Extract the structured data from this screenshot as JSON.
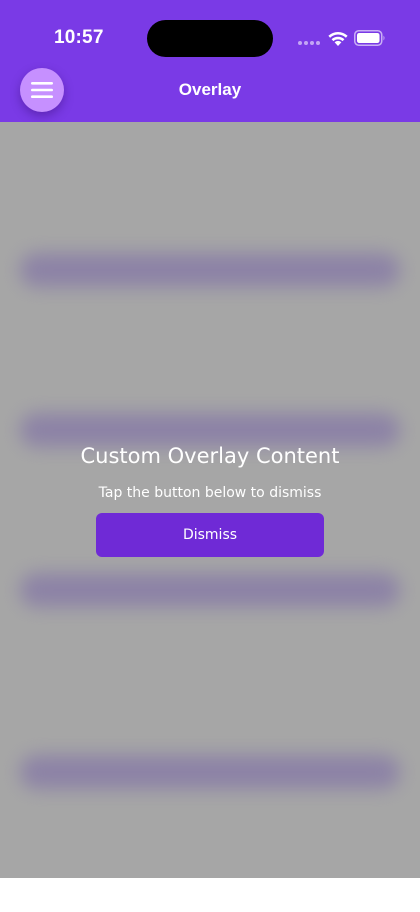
{
  "status_bar": {
    "time": "10:57"
  },
  "header": {
    "title": "Overlay",
    "menu_icon": "hamburger-menu-icon",
    "background_color": "#7a3ae6",
    "menu_button_color": "#c690ff"
  },
  "overlay": {
    "title": "Custom Overlay Content",
    "subtitle": "Tap the button below to dismiss",
    "dismiss_label": "Dismiss",
    "button_color": "#6f2ad6",
    "scrim_color": "#a6a6a6"
  }
}
